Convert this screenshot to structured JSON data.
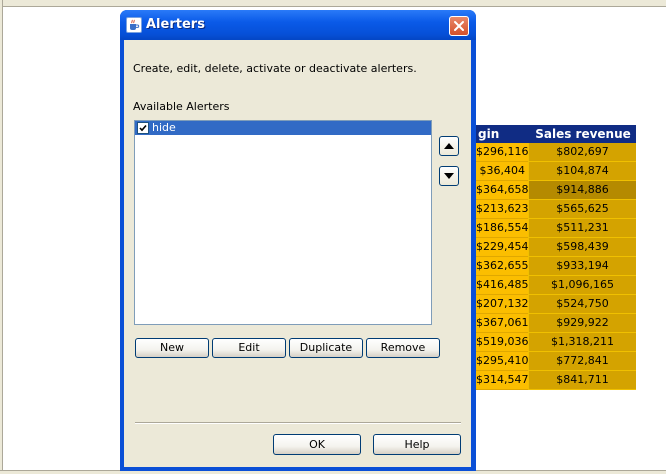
{
  "dialog": {
    "title": "Alerters",
    "description": "Create, edit, delete, activate or deactivate alerters.",
    "list_label": "Available Alerters",
    "alerters": [
      {
        "label": "hide",
        "checked": true,
        "selected": true
      }
    ],
    "buttons": {
      "new": "New",
      "edit": "Edit",
      "duplicate": "Duplicate",
      "remove": "Remove",
      "ok": "OK",
      "help": "Help"
    }
  },
  "report": {
    "columns": [
      "gin",
      "Sales revenue"
    ],
    "rows": [
      [
        "$296,116",
        "$802,697"
      ],
      [
        "$36,404",
        "$104,874"
      ],
      [
        "$364,658",
        "$914,886"
      ],
      [
        "$213,623",
        "$565,625"
      ],
      [
        "$186,554",
        "$511,231"
      ],
      [
        "$229,454",
        "$598,439"
      ],
      [
        "$362,655",
        "$933,194"
      ],
      [
        "$416,485",
        "$1,096,165"
      ],
      [
        "$207,132",
        "$524,750"
      ],
      [
        "$367,061",
        "$929,922"
      ],
      [
        "$519,036",
        "$1,318,211"
      ],
      [
        "$295,410",
        "$772,841"
      ],
      [
        "$314,547",
        "$841,711"
      ]
    ],
    "highlighted_row": 2
  },
  "colors": {
    "titlebar": "#0a5ae8",
    "header": "#102c84",
    "cell_margin": "#fbbe00",
    "cell_revenue": "#d4a300",
    "selection": "#316ac5"
  },
  "icons": {
    "title": "java-cup-icon",
    "close": "close-icon",
    "up": "arrow-up-icon",
    "down": "arrow-down-icon",
    "check": "checkmark-icon"
  }
}
